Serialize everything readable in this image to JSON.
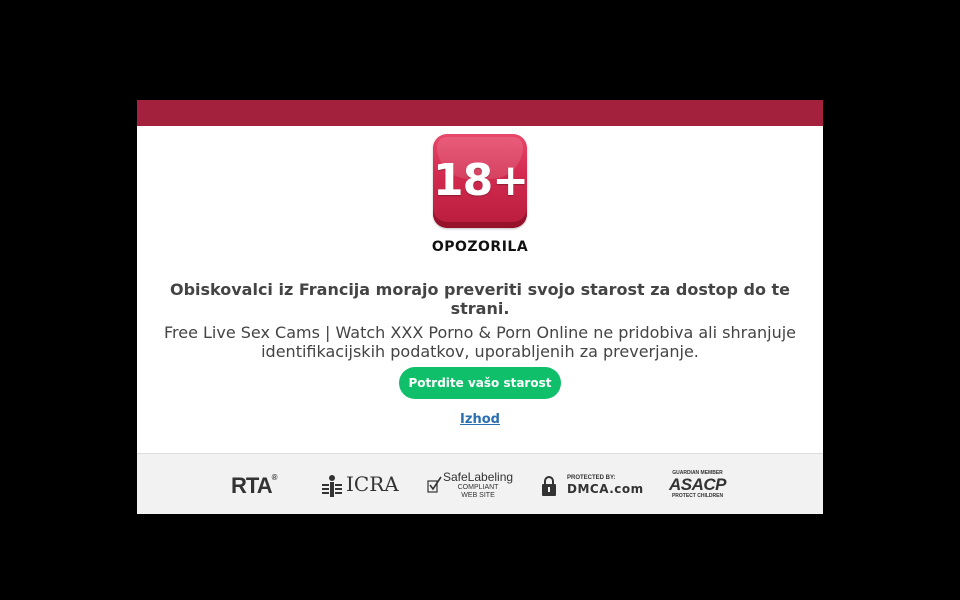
{
  "badge": {
    "text": "18+"
  },
  "warning_title": "OPOZORILA",
  "headline": "Obiskovalci iz Francija morajo preveriti svojo starost za dostop do te strani.",
  "subtext": "Free Live Sex Cams | Watch XXX Porno & Porn Online ne pridobiva ali shranjuje identifikacijskih podatkov, uporabljenih za preverjanje.",
  "buttons": {
    "confirm_label": "Potrdite vašo starost",
    "exit_label": "Izhod"
  },
  "footer": {
    "rta": {
      "text": "RTA",
      "mark": "®"
    },
    "icra": {
      "text": "ICRA"
    },
    "safelabeling": {
      "main": "SafeLabeling",
      "line1": "COMPLIANT",
      "line2": "WEB SITE"
    },
    "dmca": {
      "small": "PROTECTED BY:",
      "big": "DMCA.com"
    },
    "asacp": {
      "small": "GUARDIAN MEMBER",
      "big": "ASACP",
      "sub": "PROTECT CHILDREN"
    }
  },
  "colors": {
    "topbar": "#a3213c",
    "badge": "#d12a4e",
    "confirm_button": "#0fbf6a",
    "link": "#2a6fb0"
  }
}
